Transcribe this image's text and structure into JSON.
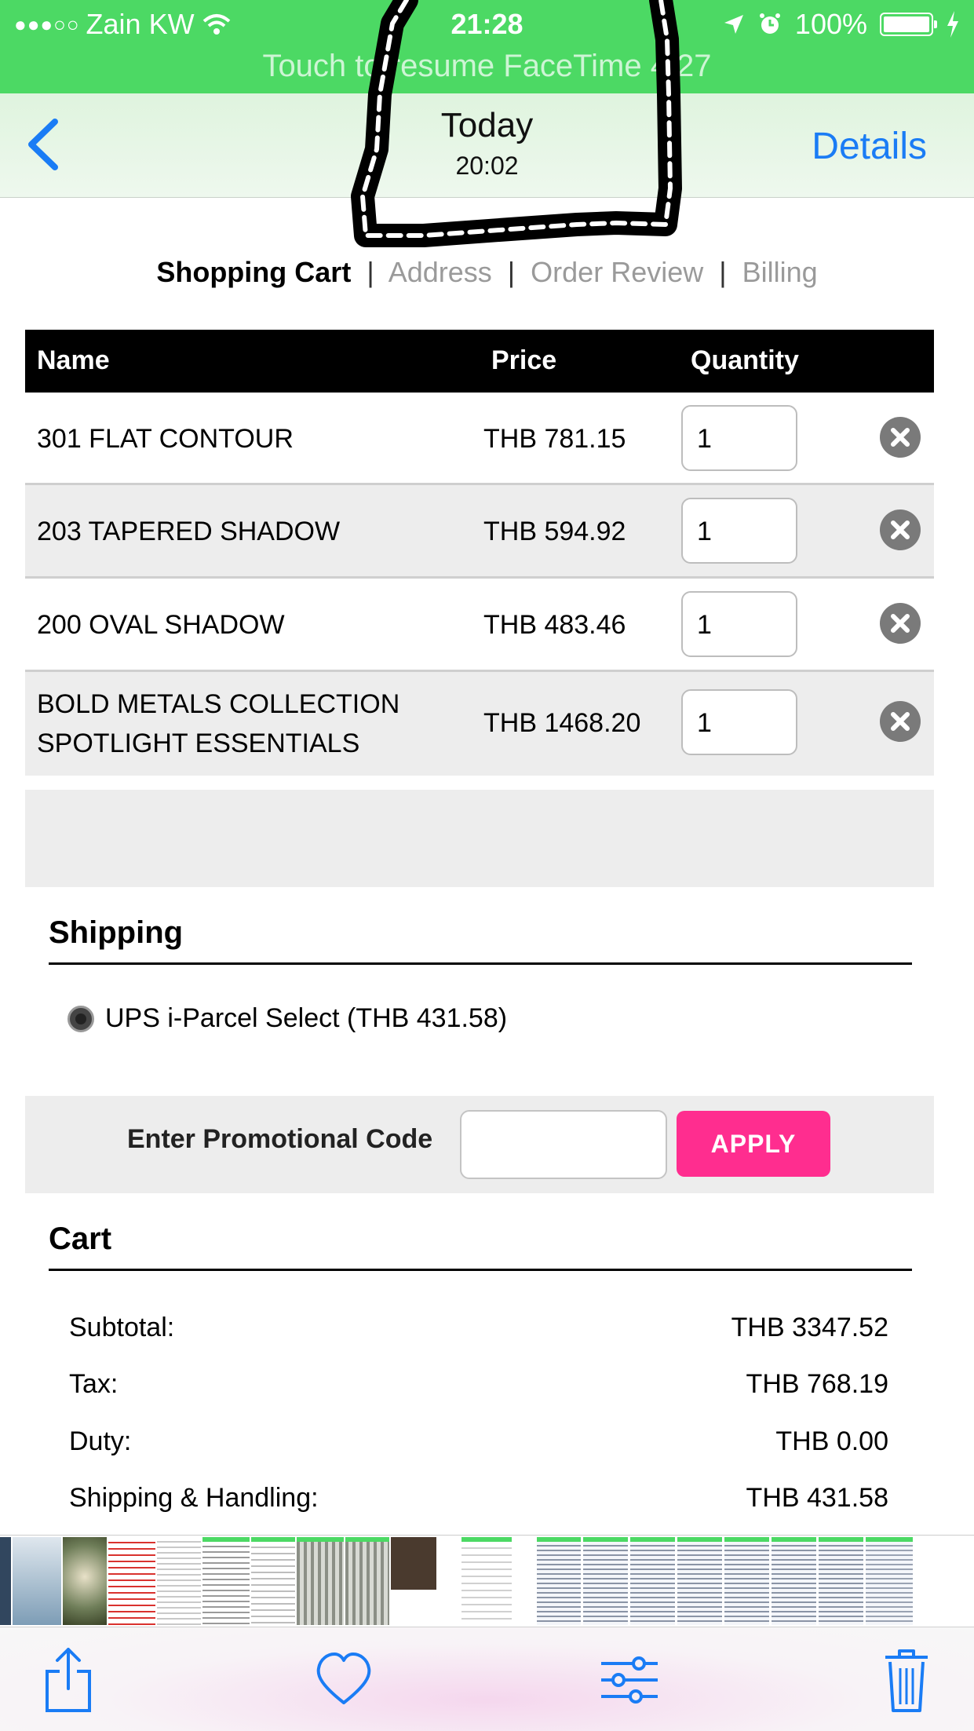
{
  "status_bar": {
    "signal": "●●●○○",
    "carrier": "Zain KW",
    "time": "21:28",
    "battery": "100%",
    "battery_level": 1.0,
    "banner": "Touch to resume FaceTime 4:27"
  },
  "nav": {
    "title": "Today",
    "subtitle": "20:02",
    "details": "Details"
  },
  "checkout_steps": {
    "active": "Shopping Cart",
    "sep": "|",
    "address": "Address",
    "review": "Order Review",
    "billing": "Billing"
  },
  "cart_table": {
    "headers": {
      "name": "Name",
      "price": "Price",
      "quantity": "Quantity"
    },
    "rows": [
      {
        "name_line1": "301 FLAT CONTOUR",
        "name_line2": "",
        "price": "THB 781.15",
        "quantity": "1"
      },
      {
        "name_line1": "203 TAPERED SHADOW",
        "name_line2": "",
        "price": "THB 594.92",
        "quantity": "1"
      },
      {
        "name_line1": "200 OVAL SHADOW",
        "name_line2": "",
        "price": "THB 483.46",
        "quantity": "1"
      },
      {
        "name_line1": "BOLD METALS COLLECTION",
        "name_line2": "SPOTLIGHT ESSENTIALS",
        "price": "THB 1468.20",
        "quantity": "1"
      }
    ]
  },
  "shipping": {
    "title": "Shipping",
    "option": "UPS i-Parcel Select (THB 431.58)"
  },
  "promo": {
    "label": "Enter Promotional Code",
    "value": "",
    "apply": "APPLY"
  },
  "cart_summary": {
    "title": "Cart",
    "subtotal_label": "Subtotal:",
    "subtotal": "THB 3347.52",
    "tax_label": "Tax:",
    "tax": "THB 768.19",
    "duty_label": "Duty:",
    "duty": "THB 0.00",
    "shipping_label": "Shipping & Handling:",
    "shipping": "THB 431.58"
  },
  "colors": {
    "status_green": "#4cd964",
    "ios_blue": "#1a7cf5",
    "apply_pink": "#ff2d8f"
  }
}
